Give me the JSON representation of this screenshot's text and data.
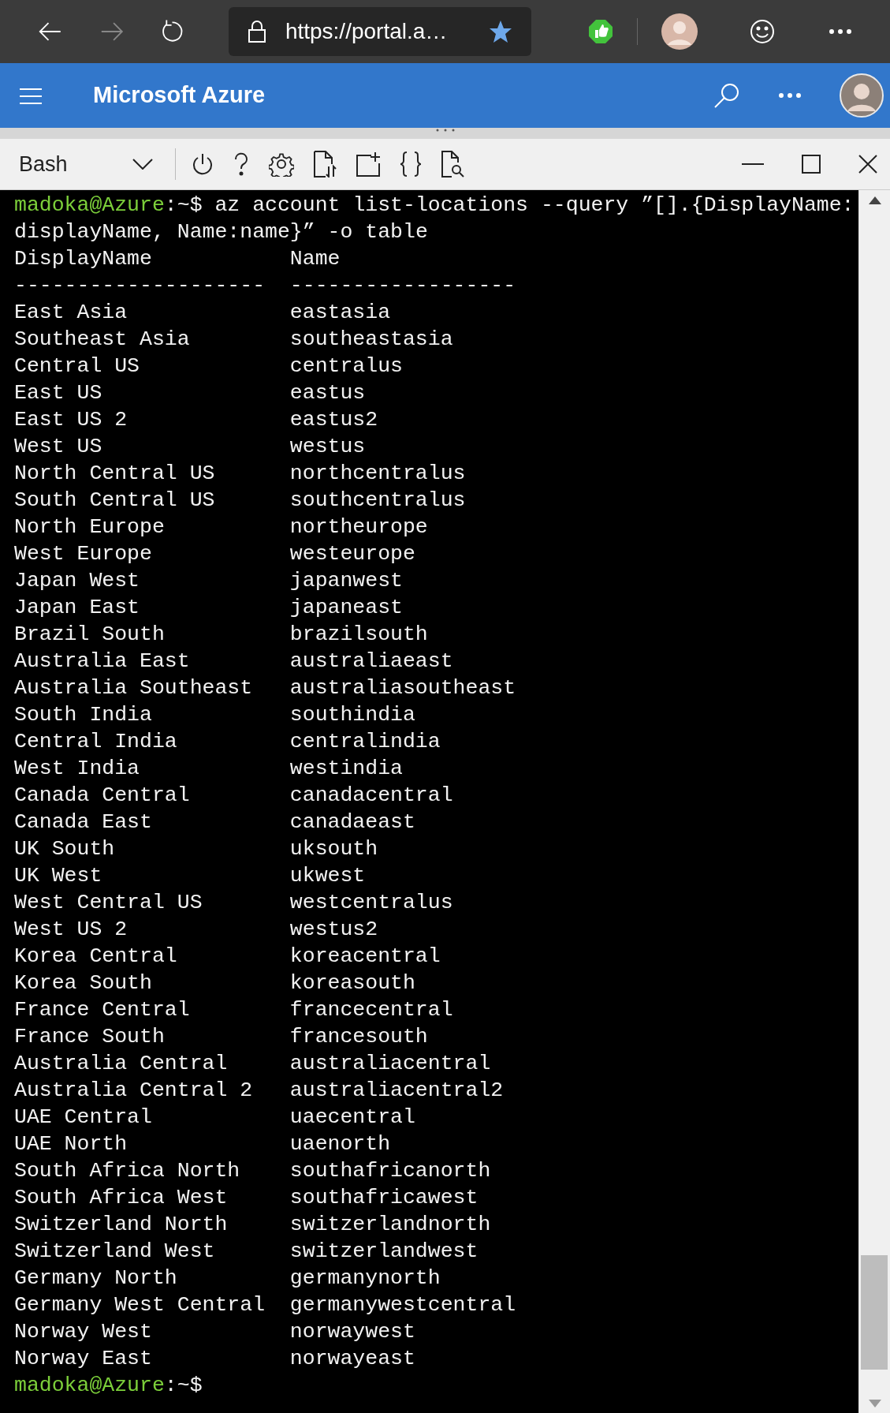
{
  "browser": {
    "url": "https://portal.a…",
    "favorite": true
  },
  "header": {
    "title": "Microsoft Azure"
  },
  "shell_toolbar": {
    "shell": "Bash"
  },
  "terminal": {
    "command": {
      "user": "madoka@Azure",
      "separator": ":",
      "path": "~",
      "symbol": "$",
      "lines": [
        "az account list-locations --query ”[].{DisplayName:",
        "displayName, Name:name}” -o table"
      ]
    },
    "columns": [
      "DisplayName",
      "Name"
    ],
    "rules": [
      "--------------------",
      "------------------"
    ],
    "rows": [
      {
        "display_name": "East Asia",
        "name": "eastasia"
      },
      {
        "display_name": "Southeast Asia",
        "name": "southeastasia"
      },
      {
        "display_name": "Central US",
        "name": "centralus"
      },
      {
        "display_name": "East US",
        "name": "eastus"
      },
      {
        "display_name": "East US 2",
        "name": "eastus2"
      },
      {
        "display_name": "West US",
        "name": "westus"
      },
      {
        "display_name": "North Central US",
        "name": "northcentralus"
      },
      {
        "display_name": "South Central US",
        "name": "southcentralus"
      },
      {
        "display_name": "North Europe",
        "name": "northeurope"
      },
      {
        "display_name": "West Europe",
        "name": "westeurope"
      },
      {
        "display_name": "Japan West",
        "name": "japanwest"
      },
      {
        "display_name": "Japan East",
        "name": "japaneast"
      },
      {
        "display_name": "Brazil South",
        "name": "brazilsouth"
      },
      {
        "display_name": "Australia East",
        "name": "australiaeast"
      },
      {
        "display_name": "Australia Southeast",
        "name": "australiasoutheast"
      },
      {
        "display_name": "South India",
        "name": "southindia"
      },
      {
        "display_name": "Central India",
        "name": "centralindia"
      },
      {
        "display_name": "West India",
        "name": "westindia"
      },
      {
        "display_name": "Canada Central",
        "name": "canadacentral"
      },
      {
        "display_name": "Canada East",
        "name": "canadaeast"
      },
      {
        "display_name": "UK South",
        "name": "uksouth"
      },
      {
        "display_name": "UK West",
        "name": "ukwest"
      },
      {
        "display_name": "West Central US",
        "name": "westcentralus"
      },
      {
        "display_name": "West US 2",
        "name": "westus2"
      },
      {
        "display_name": "Korea Central",
        "name": "koreacentral"
      },
      {
        "display_name": "Korea South",
        "name": "koreasouth"
      },
      {
        "display_name": "France Central",
        "name": "francecentral"
      },
      {
        "display_name": "France South",
        "name": "francesouth"
      },
      {
        "display_name": "Australia Central",
        "name": "australiacentral"
      },
      {
        "display_name": "Australia Central 2",
        "name": "australiacentral2"
      },
      {
        "display_name": "UAE Central",
        "name": "uaecentral"
      },
      {
        "display_name": "UAE North",
        "name": "uaenorth"
      },
      {
        "display_name": "South Africa North",
        "name": "southafricanorth"
      },
      {
        "display_name": "South Africa West",
        "name": "southafricawest"
      },
      {
        "display_name": "Switzerland North",
        "name": "switzerlandnorth"
      },
      {
        "display_name": "Switzerland West",
        "name": "switzerlandwest"
      },
      {
        "display_name": "Germany North",
        "name": "germanynorth"
      },
      {
        "display_name": "Germany West Central",
        "name": "germanywestcentral"
      },
      {
        "display_name": "Norway West",
        "name": "norwaywest"
      },
      {
        "display_name": "Norway East",
        "name": "norwayeast"
      }
    ],
    "final_prompt": {
      "user": "madoka@Azure",
      "separator": ":",
      "path": "~",
      "symbol": "$"
    }
  }
}
